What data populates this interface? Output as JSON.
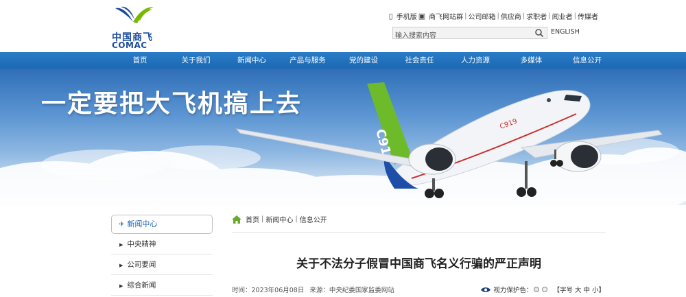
{
  "logo": {
    "cn": "中国商飞",
    "en": "COMAC"
  },
  "toplinks": [
    "手机版",
    "商飞网站群",
    "公司邮箱",
    "供应商",
    "求职者",
    "闻业者",
    "传媒者"
  ],
  "search": {
    "placeholder": "输入搜索内容"
  },
  "english": "ENGLISH",
  "nav": [
    "首页",
    "关于我们",
    "新闻中心",
    "产品与服务",
    "党的建设",
    "社会责任",
    "人力资源",
    "多媒体",
    "信息公开"
  ],
  "banner": {
    "slogan": "一定要把大飞机搞上去",
    "plane_label": "C919"
  },
  "sidebar": {
    "title": "新闻中心",
    "items": [
      "中央精神",
      "公司要闻",
      "综合新闻"
    ]
  },
  "breadcrumb": [
    "首页",
    "新闻中心",
    "信息公开"
  ],
  "article": {
    "title": "关于不法分子假冒中国商飞名义行骗的严正声明",
    "time_label": "时间：2023年06月08日",
    "source_label": "来源：中央纪委国家监委网站",
    "eye_label": "视力保护色：",
    "font_size": "【字号 大 中 小】"
  },
  "colors": {
    "brand": "#1a4c9c",
    "nav": "#1c68b3",
    "green": "#7ab800"
  }
}
